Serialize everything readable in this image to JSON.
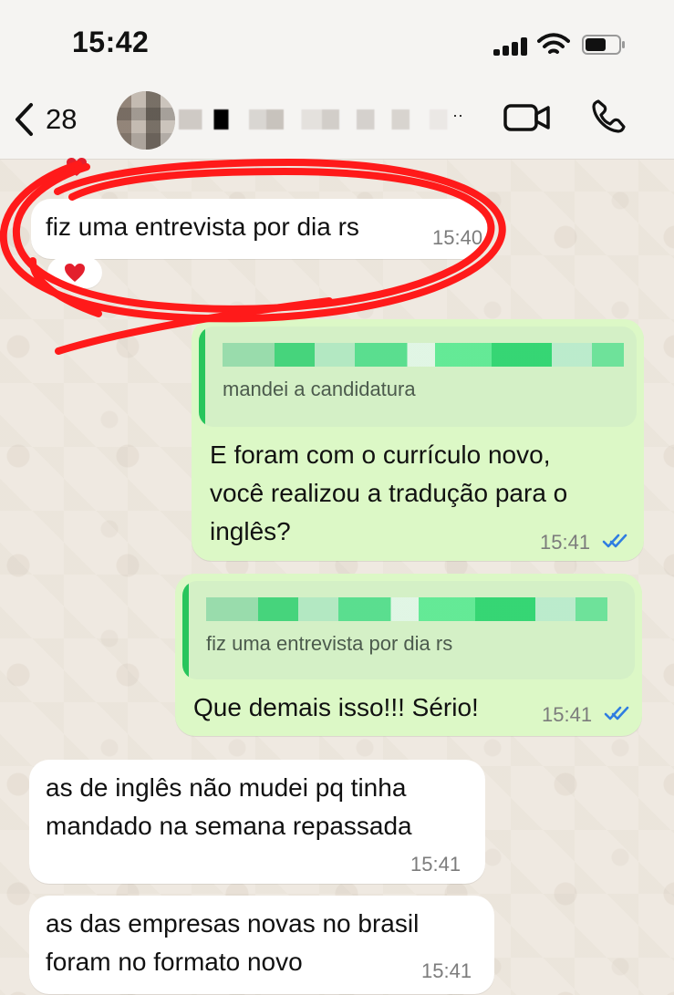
{
  "status_bar": {
    "time": "15:42"
  },
  "header": {
    "back_count": "28",
    "contact_name_ellipsis": "··"
  },
  "messages": [
    {
      "text": "fiz uma entrevista por dia rs",
      "time": "15:40"
    },
    {
      "quote_text": "mandei a candidatura",
      "text": "E foram com o currículo novo,\nvocê realizou a tradução para o\ninglês?",
      "time": "15:41"
    },
    {
      "quote_text": "fiz uma entrevista por dia rs",
      "text": "Que demais isso!!! Sério!",
      "time": "15:41"
    },
    {
      "text": "as de inglês não mudei pq tinha\nmandado na semana repassada",
      "time": "15:41"
    },
    {
      "text": "as das empresas novas no brasil\nforam no formato novo",
      "time": "15:41"
    }
  ],
  "colors": {
    "sent_bubble": "#dcf8c6",
    "received_bubble": "#ffffff",
    "accent_green": "#28c55c",
    "read_receipt_blue": "#2f7de1",
    "annotation_red": "#ff1a1a"
  },
  "icons": {
    "back": "chevron-left-icon",
    "video": "video-call-icon",
    "phone": "phone-call-icon",
    "signal": "signal-icon",
    "wifi": "wifi-icon",
    "battery": "battery-icon",
    "heart": "heart-icon",
    "read": "double-check-icon"
  }
}
